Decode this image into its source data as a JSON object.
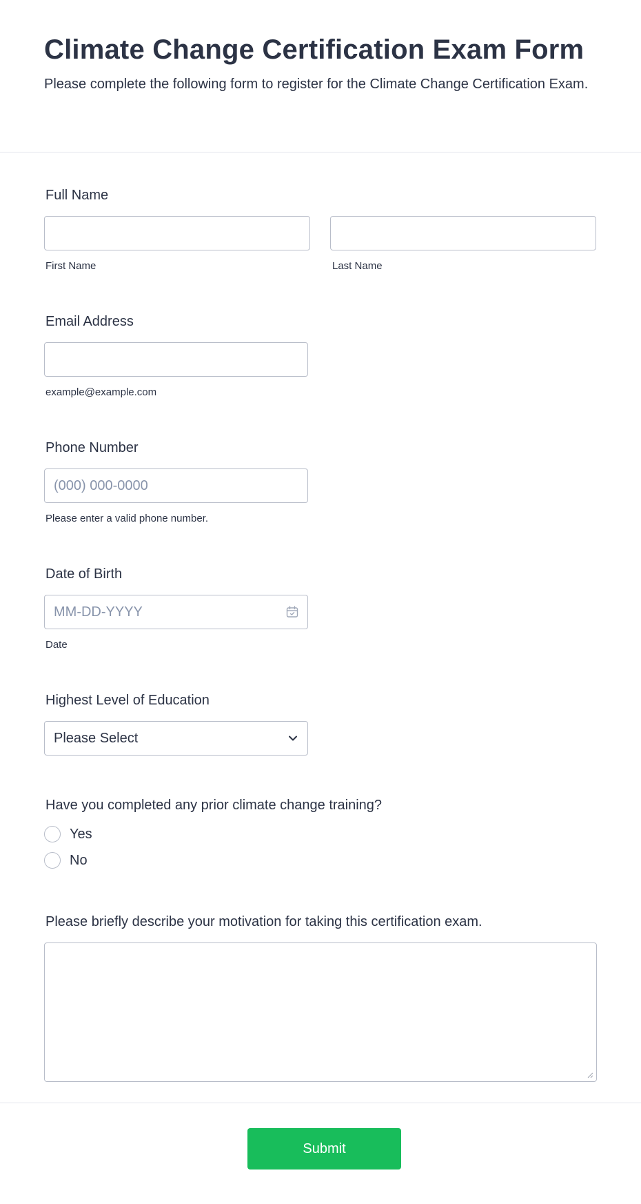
{
  "form": {
    "title": "Climate Change Certification Exam Form",
    "subtitle": "Please complete the following form to register for the Climate Change Certification Exam."
  },
  "full_name": {
    "label": "Full Name",
    "first_sublabel": "First Name",
    "last_sublabel": "Last Name",
    "first_value": "",
    "last_value": ""
  },
  "email": {
    "label": "Email Address",
    "value": "",
    "sublabel": "example@example.com"
  },
  "phone": {
    "label": "Phone Number",
    "placeholder": "(000) 000-0000",
    "sublabel": "Please enter a valid phone number."
  },
  "dob": {
    "label": "Date of Birth",
    "placeholder": "MM-DD-YYYY",
    "sublabel": "Date",
    "icon": "calendar-icon"
  },
  "education": {
    "label": "Highest Level of Education",
    "selected": "Please Select",
    "icon": "chevron-down-icon"
  },
  "prior_training": {
    "question": "Have you completed any prior climate change training?",
    "options": [
      "Yes",
      "No"
    ]
  },
  "motivation": {
    "label": "Please briefly describe your motivation for taking this certification exam.",
    "value": ""
  },
  "submit": {
    "label": "Submit"
  },
  "colors": {
    "accent": "#18bd5b",
    "text": "#2c3345",
    "placeholder": "#8894ab",
    "border": "#b8bdc9",
    "background": "#ffffff"
  }
}
